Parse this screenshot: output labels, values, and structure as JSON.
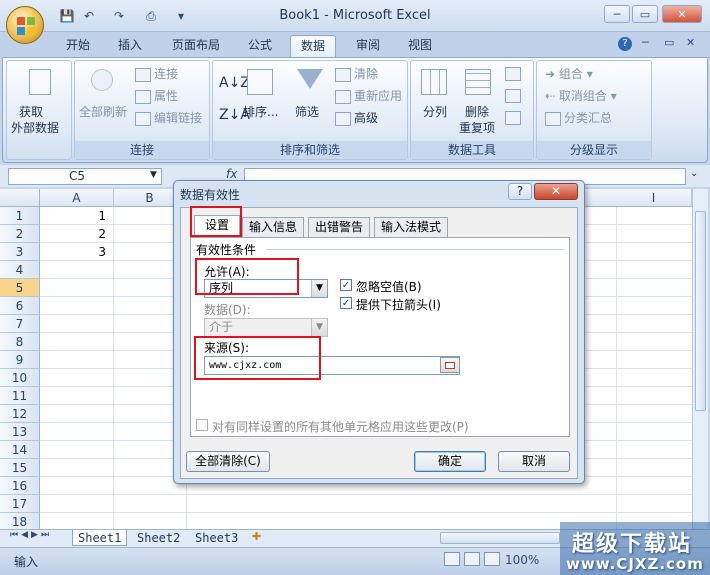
{
  "window": {
    "title": "Book1 - Microsoft Excel",
    "controls": {
      "minimize": "─",
      "restore": "▭",
      "close": "✕"
    }
  },
  "ribbon_tabs": [
    "开始",
    "插入",
    "页面布局",
    "公式",
    "数据",
    "审阅",
    "视图"
  ],
  "active_tab": "数据",
  "ribbon": {
    "get_external": {
      "line1": "获取",
      "line2": "外部数据"
    },
    "connections": {
      "refresh_all": "全部刷新",
      "connections": "连接",
      "properties": "属性",
      "edit_links": "编辑链接",
      "label": "连接"
    },
    "sort_filter": {
      "sort": "排序...",
      "filter": "筛选",
      "clear": "清除",
      "reapply": "重新应用",
      "advanced": "高级",
      "label": "排序和筛选"
    },
    "data_tools": {
      "split": "分列",
      "remove_dup1": "删除",
      "remove_dup2": "重复项",
      "label": "数据工具"
    },
    "outline": {
      "group": "组合",
      "ungroup": "取消组合",
      "subtotal": "分类汇总",
      "label": "分级显示"
    }
  },
  "formula_bar": {
    "name_box": "C5",
    "fx": "fx"
  },
  "columns": [
    "A",
    "B",
    "I"
  ],
  "rows": [
    "1",
    "2",
    "3",
    "4",
    "5",
    "6",
    "7",
    "8",
    "9",
    "10",
    "11",
    "12",
    "13",
    "14",
    "15",
    "16",
    "17",
    "18"
  ],
  "cells_A": [
    "1",
    "2",
    "3"
  ],
  "sheet_tabs": [
    "Sheet1",
    "Sheet2",
    "Sheet3"
  ],
  "status": {
    "mode": "输入",
    "zoom": "100%"
  },
  "watermark": {
    "line1": "超级下载站",
    "line2": "www.CJXZ.com"
  },
  "dialog": {
    "title": "数据有效性",
    "help": "?",
    "close": "✕",
    "tabs": [
      "设置",
      "输入信息",
      "出错警告",
      "输入法模式"
    ],
    "section": "有效性条件",
    "allow_label": "允许(A):",
    "allow_value": "序列",
    "ignore_blank": "忽略空值(B)",
    "dropdown": "提供下拉箭头(I)",
    "data_label": "数据(D):",
    "data_value": "介于",
    "source_label": "来源(S):",
    "source_value": "www.cjxz.com",
    "apply_all": "对有同样设置的所有其他单元格应用这些更改(P)",
    "clear_all": "全部清除(C)",
    "ok": "确定",
    "cancel": "取消"
  }
}
